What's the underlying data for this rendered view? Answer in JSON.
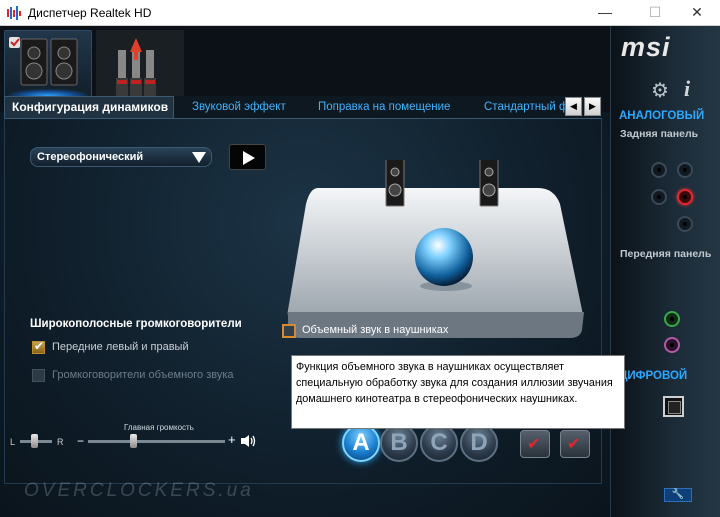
{
  "window": {
    "title": "Диспетчер Realtek HD",
    "minimize": "—",
    "maximize": "☐",
    "close": "✕"
  },
  "devices": [
    {
      "name": "speakers-device",
      "selected": true
    },
    {
      "name": "rca-connector-device",
      "selected": false
    }
  ],
  "tabs": {
    "active": "Конфигурация динамиков",
    "items": [
      "Звуковой эффект",
      "Поправка на помещение",
      "Стандартный ф"
    ],
    "scroll_left": "◀",
    "scroll_right": "▶"
  },
  "config": {
    "selected": "Стереофонический"
  },
  "fullrange": {
    "title": "Широкополосные громкоговорители",
    "front": {
      "label": "Передние левый и правый",
      "checked": true
    },
    "surround": {
      "label": "Громкоговорители объемного звука",
      "checked": false,
      "disabled": true
    }
  },
  "surround_headphones": {
    "label": "Объемный звук в наушниках",
    "checked": false
  },
  "tooltip": {
    "line1": "Функция объемного звука в наушниках осуществляет",
    "line2": "специальную обработку звука для создания иллюзии звучания",
    "line3": "домашнего кинотеатра в стереофонических наушниках."
  },
  "volume": {
    "title": "Главная громкость",
    "left": "L",
    "right": "R",
    "minus": "−",
    "plus": "+",
    "balance": 0.5,
    "level": 0.3
  },
  "profiles": [
    "A",
    "B",
    "C",
    "D"
  ],
  "active_profile": "A",
  "watermark": "OVERCLOCKERS.ua",
  "sidebar": {
    "logo": "msi",
    "info": "i",
    "analog": "АНАЛОГОВЫЙ",
    "rear_panel": "Задняя панель",
    "front_panel": "Передняя панель",
    "digital": "ЦИФРОВОЙ",
    "wrench": "🔧"
  },
  "colors": {
    "accent": "#2ba8ff",
    "active_jack": "#e0262b",
    "front_green": "#3aa64a",
    "front_pink": "#b05aa8"
  }
}
